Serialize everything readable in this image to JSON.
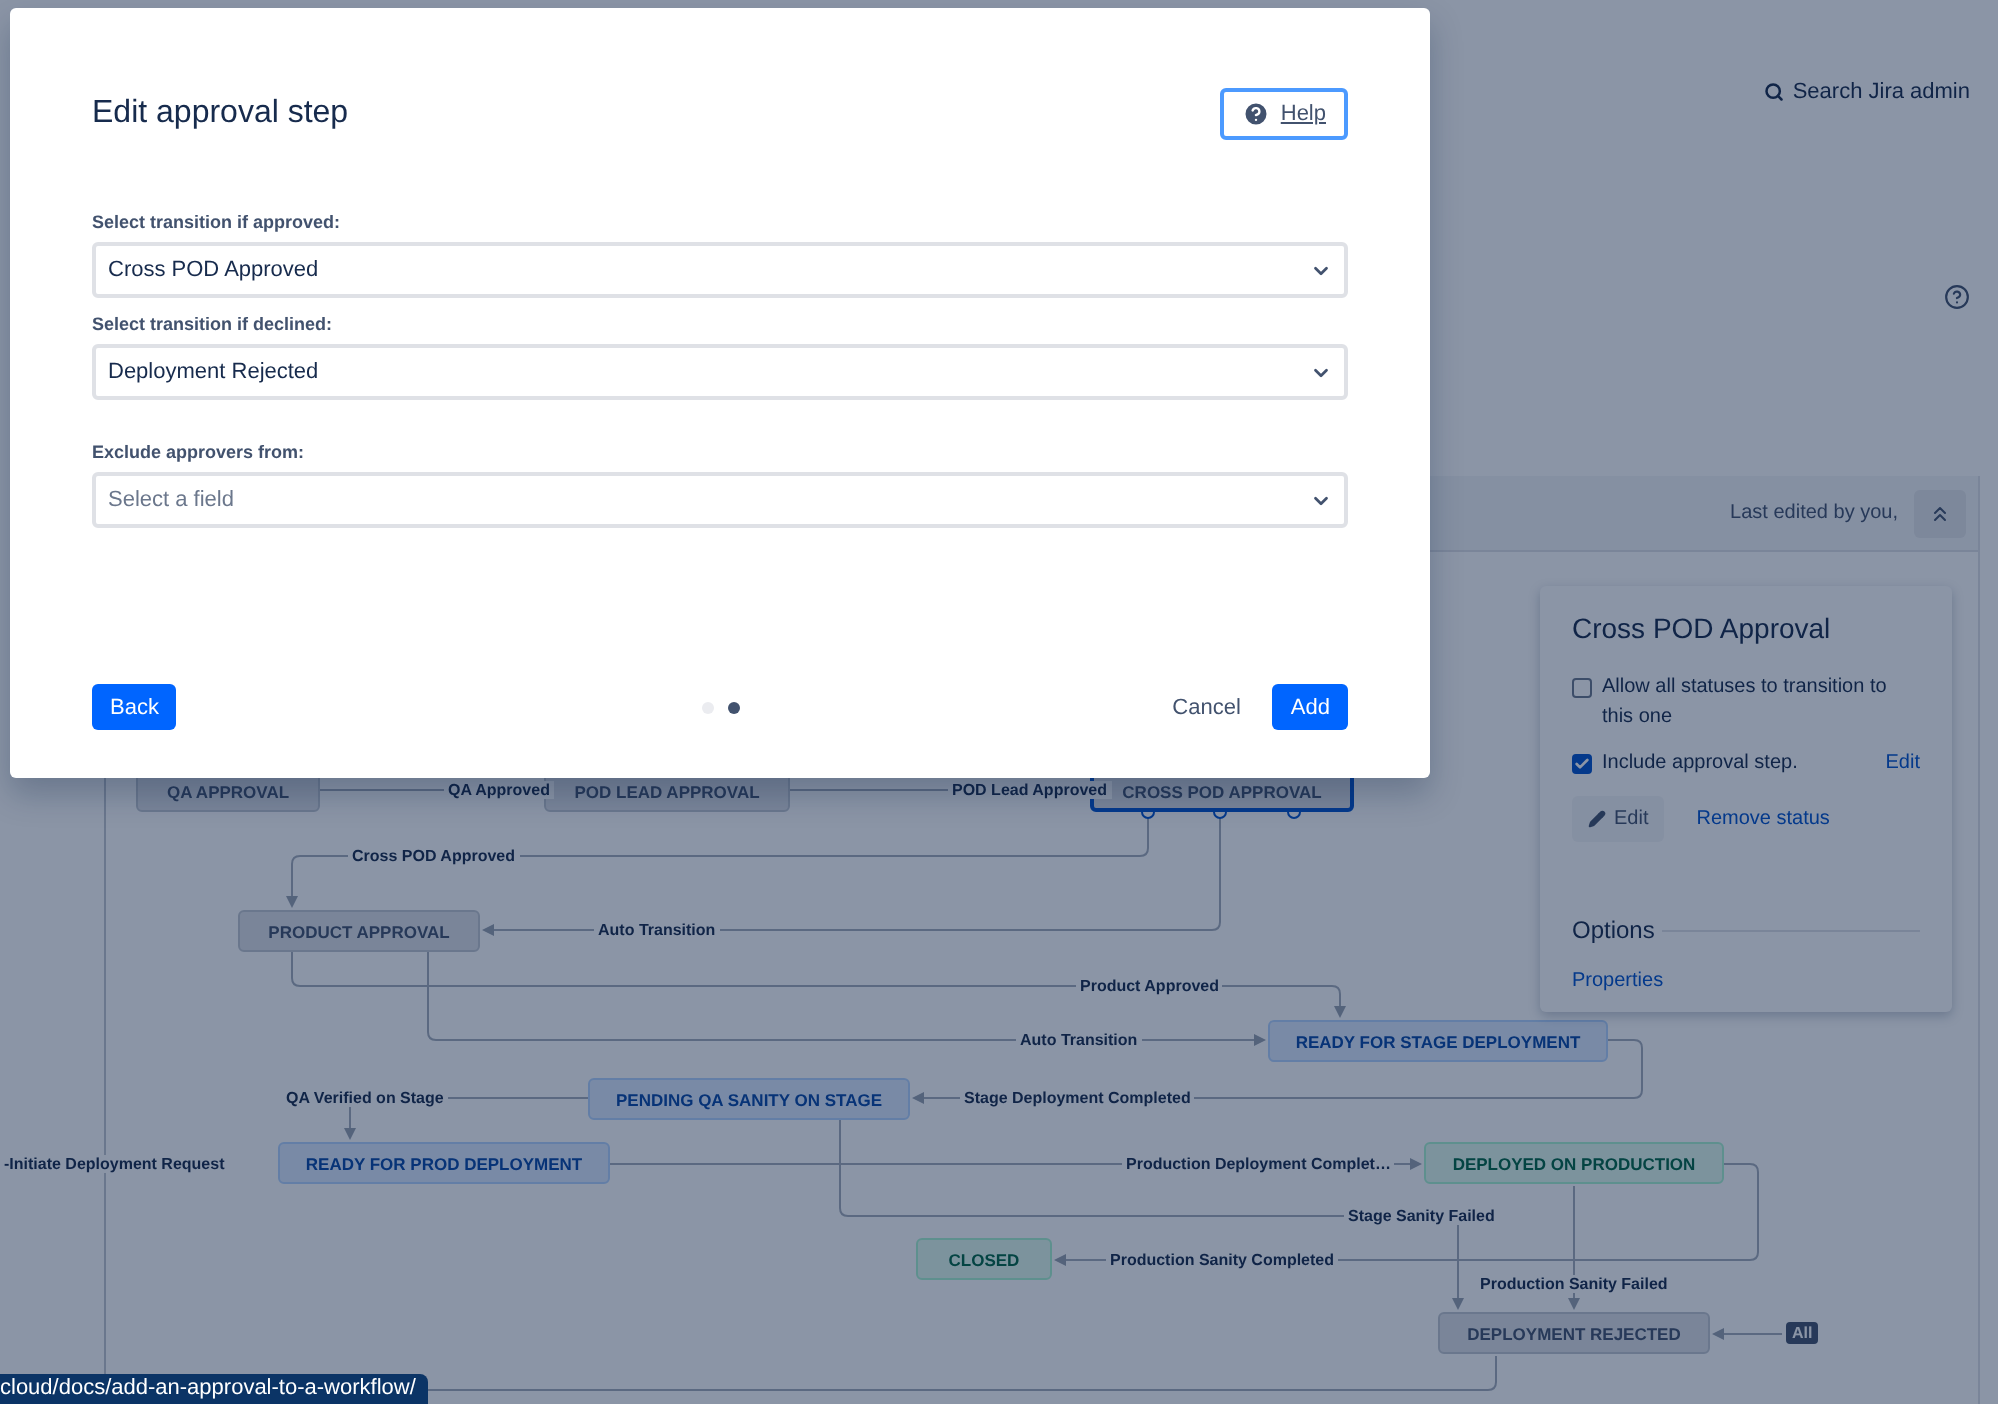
{
  "header": {
    "search_label": "Search Jira admin"
  },
  "workflow": {
    "last_edited": "Last edited by you,",
    "nodes": [
      {
        "label": "QA APPROVAL",
        "kind": "todo",
        "selected": false
      },
      {
        "label": "POD LEAD APPROVAL",
        "kind": "todo",
        "selected": false
      },
      {
        "label": "CROSS POD APPROVAL",
        "kind": "todo",
        "selected": true
      },
      {
        "label": "PRODUCT APPROVAL",
        "kind": "todo",
        "selected": false
      },
      {
        "label": "READY FOR STAGE DEPLOYMENT",
        "kind": "progress",
        "selected": false
      },
      {
        "label": "PENDING QA SANITY ON STAGE",
        "kind": "progress",
        "selected": false
      },
      {
        "label": "READY FOR PROD DEPLOYMENT",
        "kind": "progress",
        "selected": false
      },
      {
        "label": "DEPLOYED ON PRODUCTION",
        "kind": "done",
        "selected": false
      },
      {
        "label": "CLOSED",
        "kind": "done",
        "selected": false
      },
      {
        "label": "DEPLOYMENT REJECTED",
        "kind": "todo",
        "selected": false
      }
    ],
    "transitions": [
      {
        "label": "QA Approved"
      },
      {
        "label": "POD Lead Approved"
      },
      {
        "label": "Cross POD Approved"
      },
      {
        "label": "Auto Transition"
      },
      {
        "label": "Product Approved"
      },
      {
        "label": "Auto Transition"
      },
      {
        "label": "QA Verified on Stage"
      },
      {
        "label": "Stage Deployment Completed"
      },
      {
        "label": "-Initiate Deployment Request"
      },
      {
        "label": "Production Deployment Complet…"
      },
      {
        "label": "Stage Sanity Failed"
      },
      {
        "label": "Production Sanity Completed"
      },
      {
        "label": "Production Sanity Failed"
      }
    ],
    "global_badge": "All"
  },
  "status_panel": {
    "title": "Cross POD Approval",
    "options": [
      {
        "label": "Allow all statuses to transition to this one",
        "checked": false
      },
      {
        "label": "Include approval step.",
        "checked": true,
        "link": "Edit"
      }
    ],
    "edit_button": "Edit",
    "remove_link": "Remove status",
    "section_title": "Options",
    "properties_link": "Properties"
  },
  "modal": {
    "title": "Edit approval step",
    "help": "Help",
    "fields": [
      {
        "label": "Select transition if approved:",
        "value": "Cross POD Approved"
      },
      {
        "label": "Select transition if declined:",
        "value": "Deployment Rejected"
      },
      {
        "label": "Exclude approvers from:",
        "placeholder": "Select a field"
      }
    ],
    "steps": [
      {
        "selected": false
      },
      {
        "selected": true
      }
    ],
    "buttons": {
      "back": "Back",
      "cancel": "Cancel",
      "add": "Add"
    }
  },
  "url_tooltip": "cloud/docs/add-an-approval-to-a-workflow/"
}
